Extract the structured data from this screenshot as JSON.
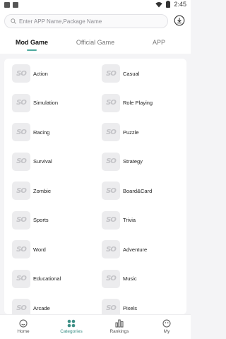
{
  "status_bar": {
    "time": "2:45"
  },
  "search": {
    "placeholder": "Enter APP Name,Package Name",
    "value": ""
  },
  "tabs": [
    {
      "label": "Mod Game",
      "active": true
    },
    {
      "label": "Official Game",
      "active": false
    },
    {
      "label": "APP",
      "active": false
    }
  ],
  "category_logo_text": "SO",
  "categories": [
    "Action",
    "Casual",
    "Simulation",
    "Role Playing",
    "Racing",
    "Puzzle",
    "Survival",
    "Strategy",
    "Zombie",
    "Board&Card",
    "Sports",
    "Trivia",
    "Word",
    "Adventure",
    "Educational",
    "Music",
    "Arcade",
    "Pixels"
  ],
  "bottom_nav": [
    {
      "label": "Home",
      "icon": "home-icon",
      "active": false
    },
    {
      "label": "Categories",
      "icon": "categories-icon",
      "active": true
    },
    {
      "label": "Rankings",
      "icon": "rankings-icon",
      "active": false
    },
    {
      "label": "My",
      "icon": "my-icon",
      "active": false
    }
  ],
  "colors": {
    "accent": "#4ea99e",
    "active_nav": "#3d8f86"
  }
}
